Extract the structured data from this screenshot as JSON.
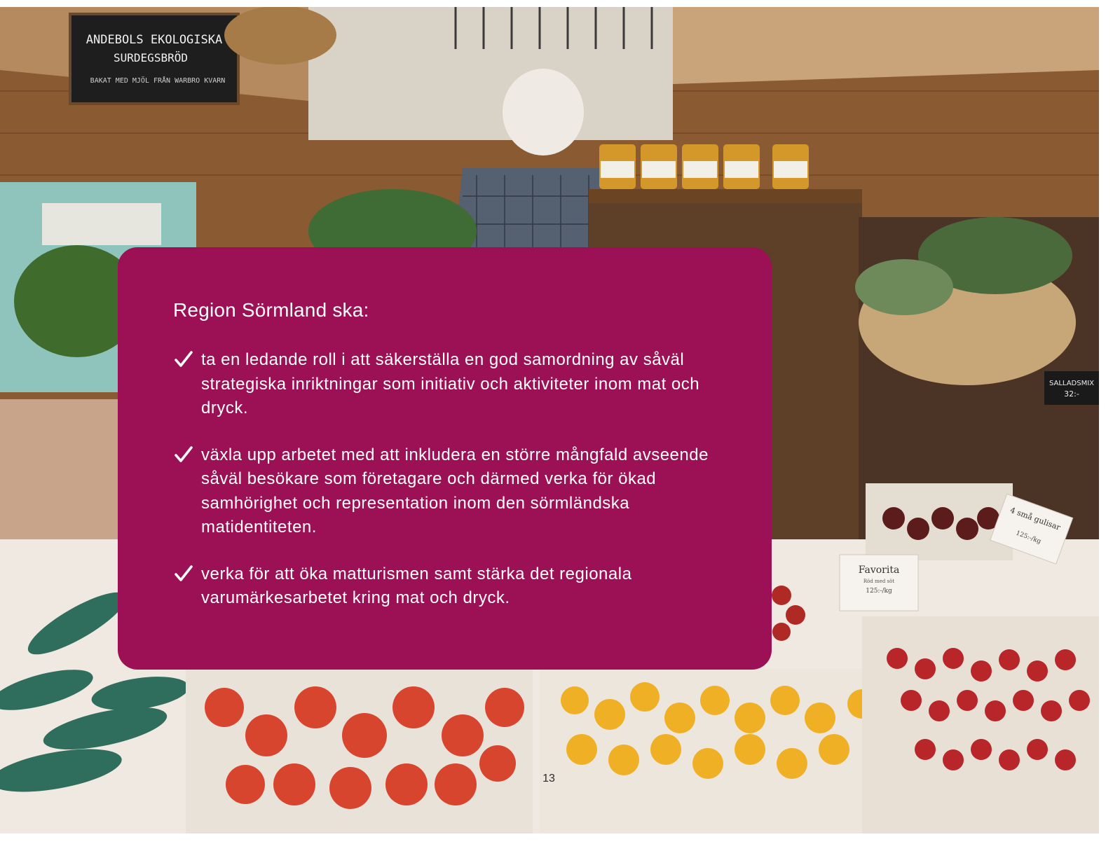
{
  "photo": {
    "sign_line1": "ANDEBOLS EKOLOGISKA",
    "sign_line2": "SURDEGSBRÖD",
    "sign_line3": "BAKAT MED MJÖL FRÅN WARBRO KVARN",
    "card_favorita_title": "Favorita",
    "card_favorita_sub": "Röd med söt",
    "card_favorita_price": "125:-/kg",
    "card_gulisar_title": "4 små gulisar",
    "card_gulisar_price": "125:-/kg",
    "card_salladsmix_title": "SALLADSMIX",
    "card_salladsmix_price": "32:-"
  },
  "panel": {
    "heading": "Region Sörmland ska:",
    "items": [
      {
        "text": "ta en ledande roll i att säkerställa en god samordning av såväl strategiska inriktningar som initiativ och aktiviteter inom mat och dryck."
      },
      {
        "text": "växla upp arbetet med att inkludera en större mångfald avseende såväl besökare som företagare och därmed verka för ökad samhörighet och representation inom den sörmländska matidentiteten."
      },
      {
        "text": "verka för att öka matturismen samt stärka det regionala varumärkesarbetet kring mat och dryck."
      }
    ],
    "check_icon": "checkmark-icon"
  },
  "page_number": "13",
  "colors": {
    "panel_bg": "#9c1055",
    "text": "#ffffff"
  }
}
